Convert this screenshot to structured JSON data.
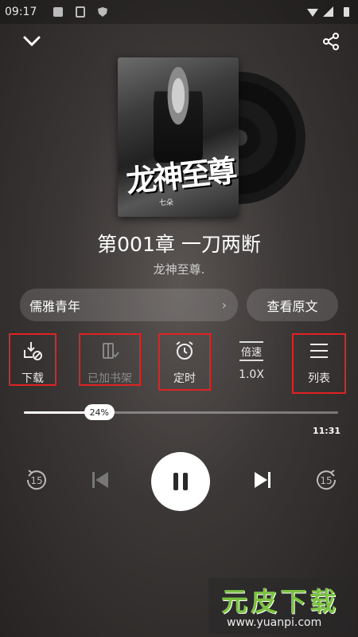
{
  "status_bar": {
    "time": "09:17"
  },
  "player": {
    "chapter_title": "第001章 一刀两断",
    "book_name": "龙神至尊.",
    "cover": {
      "title": "龙神至尊",
      "author": "七朵"
    },
    "voice_selector": {
      "label": "儒雅青年",
      "arrow": "›"
    },
    "view_original_label": "查看原文",
    "controls": {
      "download_label": "下载",
      "bookshelf_label": "已加书架",
      "timer_label": "定时",
      "speed_label": "倍速",
      "speed_value": "1.0X",
      "list_label": "列表"
    },
    "progress": {
      "percent_label": "24%",
      "fraction": 0.24,
      "duration": "11:31"
    },
    "rewind_seconds": "15",
    "forward_seconds": "15"
  },
  "watermark": {
    "logo": "元皮下载",
    "url": "www.yuanpi.com"
  },
  "colors": {
    "highlight_box": "#e02222",
    "watermark_green": "#7cc243"
  }
}
